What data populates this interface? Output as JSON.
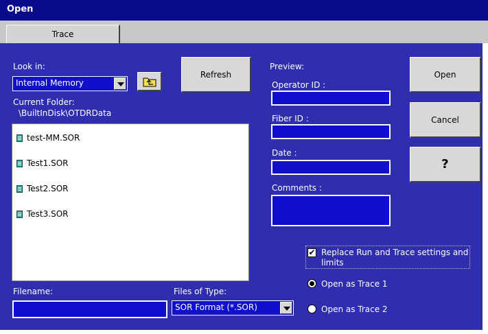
{
  "window": {
    "title": "Open"
  },
  "tabs": [
    {
      "label": "Trace"
    }
  ],
  "look_in": {
    "label": "Look in:",
    "value": "Internal Memory"
  },
  "current_folder": {
    "label": "Current Folder:",
    "path": "\\BuiltInDisk\\OTDRData"
  },
  "buttons": {
    "refresh": "Refresh",
    "open": "Open",
    "cancel": "Cancel",
    "help": "?"
  },
  "files": [
    {
      "name": "test-MM.SOR",
      "icon": "sor-file-icon"
    },
    {
      "name": "Test1.SOR",
      "icon": "sor-file-icon"
    },
    {
      "name": "Test2.SOR",
      "icon": "sor-file-icon"
    },
    {
      "name": "Test3.SOR",
      "icon": "sor-file-icon"
    }
  ],
  "filename": {
    "label": "Filename:",
    "value": ""
  },
  "file_type": {
    "label": "Files of Type:",
    "value": "SOR Format (*.SOR)"
  },
  "preview": {
    "label": "Preview:",
    "operator_id": {
      "label": "Operator ID :",
      "value": ""
    },
    "fiber_id": {
      "label": "Fiber ID :",
      "value": ""
    },
    "date": {
      "label": "Date :",
      "value": ""
    },
    "comments": {
      "label": "Comments  :",
      "value": ""
    }
  },
  "replace_settings": {
    "label": "Replace Run and Trace settings and limits",
    "checked": true
  },
  "open_as": [
    {
      "label": "Open as Trace 1",
      "selected": true
    },
    {
      "label": "Open as Trace 2",
      "selected": false
    }
  ],
  "colors": {
    "panel": "#2e2eae",
    "title_bar": "#0a0a8c",
    "field": "#1010cc"
  }
}
